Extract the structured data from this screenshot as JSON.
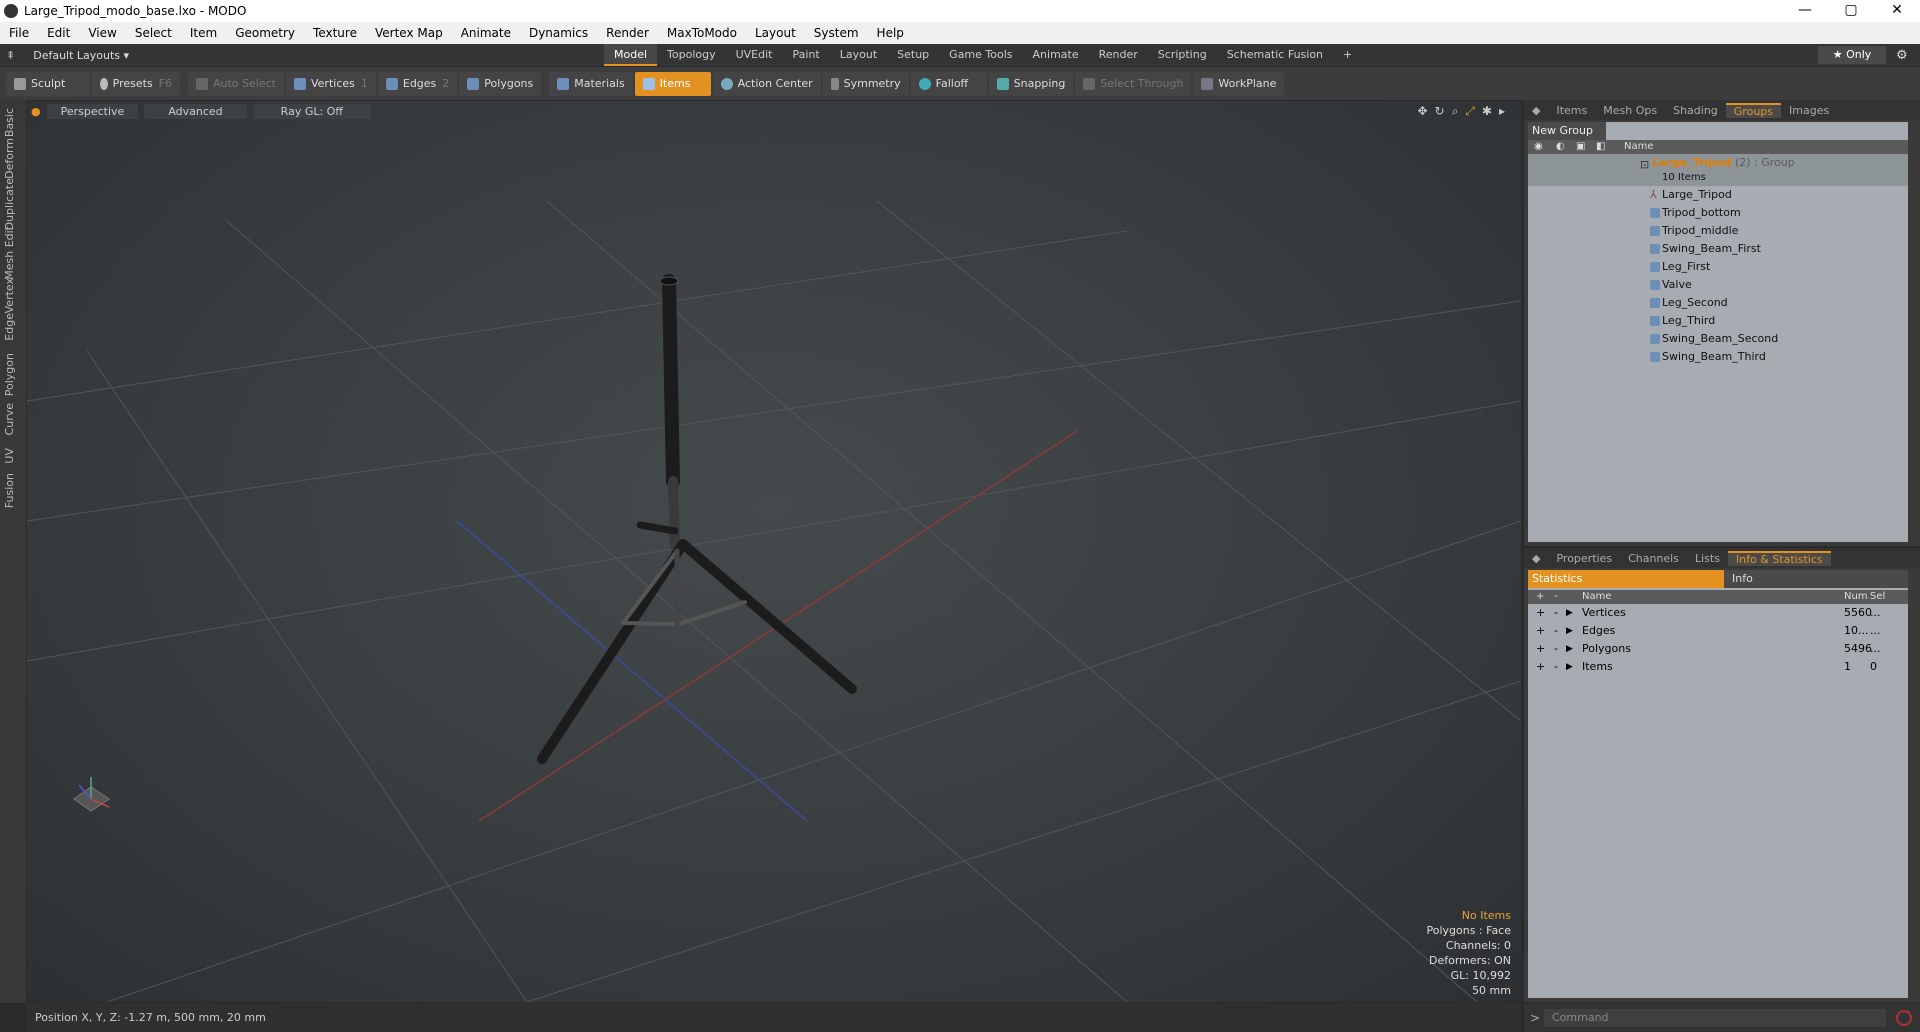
{
  "window": {
    "title": "Large_Tripod_modo_base.lxo - MODO",
    "controls": [
      "—",
      "▢",
      "✕"
    ]
  },
  "menu": [
    "File",
    "Edit",
    "View",
    "Select",
    "Item",
    "Geometry",
    "Texture",
    "Vertex Map",
    "Animate",
    "Dynamics",
    "Render",
    "MaxToModo",
    "Layout",
    "System",
    "Help"
  ],
  "layoutbar": {
    "layouts": "Default Layouts ▾",
    "tabs": [
      "Model",
      "Topology",
      "UVEdit",
      "Paint",
      "Layout",
      "Setup",
      "Game Tools",
      "Animate",
      "Render",
      "Scripting",
      "Schematic Fusion"
    ],
    "active_tab": "Model",
    "add": "+",
    "only": "★ Only",
    "gear": "⚙"
  },
  "toolbar": {
    "sculpt": "Sculpt",
    "presets": "Presets",
    "presets_key": "F6",
    "auto_select": "Auto Select",
    "vertices": "Vertices",
    "vertices_key": "1",
    "edges": "Edges",
    "edges_key": "2",
    "polygons": "Polygons",
    "materials": "Materials",
    "items": "Items",
    "action_center": "Action Center",
    "symmetry": "Symmetry",
    "falloff": "Falloff",
    "snapping": "Snapping",
    "select_through": "Select Through",
    "workplane": "WorkPlane"
  },
  "left_tabs": [
    "Basic",
    "Deform",
    "Duplicate",
    "Mesh Edit",
    "Vertex",
    "Edge",
    "Polygon",
    "Curve",
    "UV",
    "Fusion"
  ],
  "viewport": {
    "view": "Perspective",
    "shading": "Advanced",
    "raygl": "Ray GL: Off",
    "info": {
      "no_items": "No Items",
      "polygons": "Polygons : Face",
      "channels": "Channels: 0",
      "deformers": "Deformers: ON",
      "gl": "GL: 10,992",
      "scale": "50 mm"
    }
  },
  "status": {
    "position": "Position X, Y, Z:  -1.27 m, 500 mm, 20 mm"
  },
  "groups_panel": {
    "tabs": [
      "Items",
      "Mesh Ops",
      "Shading",
      "Groups",
      "Images"
    ],
    "active": "Groups",
    "new_group": "New Group",
    "name_header": "Name",
    "root": {
      "name": "Large_Tripod",
      "suffix": " (2) : Group",
      "count": "10 Items"
    },
    "children": [
      "Large_Tripod",
      "Tripod_bottom",
      "Tripod_middle",
      "Swing_Beam_First",
      "Leg_First",
      "Valve",
      "Leg_Second",
      "Leg_Third",
      "Swing_Beam_Second",
      "Swing_Beam_Third"
    ]
  },
  "stats_panel": {
    "tabs": [
      "Properties",
      "Channels",
      "Lists",
      "Info & Statistics"
    ],
    "active": "Info & Statistics",
    "sub_tabs": [
      "Statistics",
      "Info"
    ],
    "headers": {
      "name": "Name",
      "num": "Num",
      "sel": "Sel"
    },
    "rows": [
      {
        "name": "Vertices",
        "num": "5560",
        "sel": "..."
      },
      {
        "name": "Edges",
        "num": "10...",
        "sel": "..."
      },
      {
        "name": "Polygons",
        "num": "5496",
        "sel": "..."
      },
      {
        "name": "Items",
        "num": "1",
        "sel": "0"
      }
    ]
  },
  "command": {
    "placeholder": "Command"
  }
}
